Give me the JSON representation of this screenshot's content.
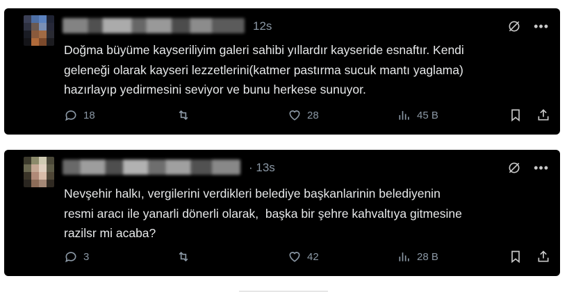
{
  "tweets": [
    {
      "time": "12s",
      "text": "Doğma büyüme kayseriliyim galeri sahibi yıllardır kayseride esnaftır. Kendi\ngeleneği olarak kayseri lezzetlerini(katmer pastırma sucuk mantı yaglama)\nhazırlayıp yedirmesini seviyor ve bunu herkese sunuyor.",
      "replies": "18",
      "likes": "28",
      "views": "45 B"
    },
    {
      "time": "· 13s",
      "text": "Nevşehir halkı, vergilerini verdikleri belediye başkanlarinin belediyenin\nresmi aracı ile yanarli dönerli olarak,  başka bir şehre kahvaltıya gitmesine\nrazilsr mi acaba?",
      "replies": "3",
      "likes": "42",
      "views": "28 B"
    }
  ],
  "icons": [
    "reply-icon",
    "retweet-icon",
    "like-icon",
    "views-icon",
    "bookmark-icon",
    "share-icon",
    "grok-icon",
    "more-icon"
  ],
  "colors": {
    "background": "#000000",
    "text": "#e7e9ea",
    "muted": "#8b98a5"
  }
}
